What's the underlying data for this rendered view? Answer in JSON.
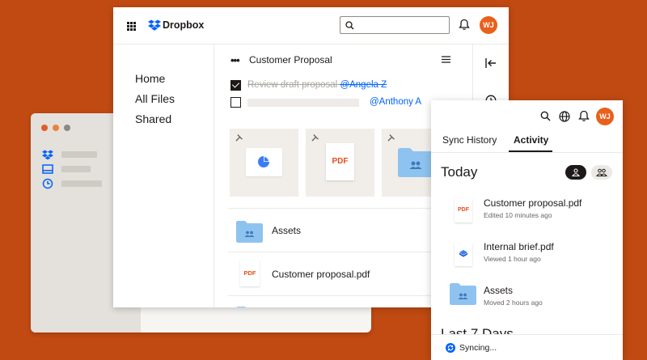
{
  "app": {
    "brand": "Dropbox",
    "avatar_initials": "WJ",
    "accent": "#0061fe",
    "avatar_color": "#e8601c",
    "background": "#c04a12"
  },
  "search": {
    "placeholder": ""
  },
  "nav": {
    "items": [
      {
        "label": "Home"
      },
      {
        "label": "All Files"
      },
      {
        "label": "Shared"
      }
    ]
  },
  "document": {
    "title": "Customer Proposal",
    "tasks": [
      {
        "text": "Review draft proposal",
        "mention": "@Angela Z",
        "done": true
      },
      {
        "text": "",
        "mention": "@Anthony A",
        "done": false
      }
    ],
    "tiles": [
      {
        "icon": "pie-chart-icon"
      },
      {
        "icon": "pdf-icon",
        "label": "PDF"
      },
      {
        "icon": "shared-folder-icon"
      }
    ]
  },
  "files": [
    {
      "name": "Assets",
      "icon": "shared-folder-icon"
    },
    {
      "name": "Customer proposal.pdf",
      "icon": "pdf-icon",
      "badge": "PDF"
    }
  ],
  "panel": {
    "tabs": [
      {
        "label": "Sync History"
      },
      {
        "label": "Activity",
        "active": true
      }
    ],
    "today_title": "Today",
    "last7_title": "Last 7 Days",
    "activity": [
      {
        "name": "Customer proposal.pdf",
        "meta": "Edited 10 minutes ago",
        "icon": "pdf-icon",
        "badge": "PDF"
      },
      {
        "name": "Internal brief.pdf",
        "meta": "Viewed 1 hour ago",
        "icon": "dropbox-file-icon"
      },
      {
        "name": "Assets",
        "meta": "Moved 2 hours ago",
        "icon": "shared-folder-icon"
      }
    ],
    "sync_status": "Syncing..."
  }
}
